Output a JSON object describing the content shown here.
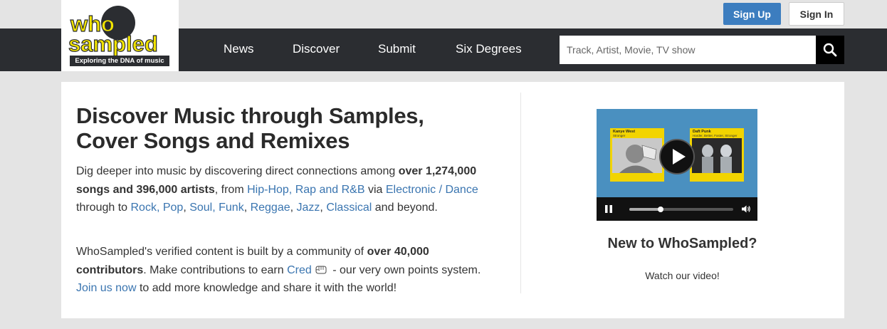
{
  "header": {
    "logo": {
      "who": "who",
      "sampled": "sampled",
      "tagline": "Exploring the DNA of music"
    },
    "sign_up": "Sign Up",
    "sign_in": "Sign In"
  },
  "nav": {
    "items": [
      "News",
      "Discover",
      "Submit",
      "Six Degrees"
    ],
    "search_placeholder": "Track, Artist, Movie, TV show"
  },
  "main": {
    "headline_line1": "Discover Music through Samples,",
    "headline_line2": "Cover Songs and Remixes",
    "intro": {
      "t1": "Dig deeper into music by discovering direct connections among ",
      "b1": "over 1,274,000 songs and 396,000 artists",
      "t2": ", from ",
      "l1": "Hip-Hop, Rap and R&B",
      "t3": " via ",
      "l2": "Electronic / Dance",
      "t4": " through to ",
      "l3": "Rock, Pop",
      "t5": ", ",
      "l4": "Soul, Funk",
      "t6": ", ",
      "l5": "Reggae",
      "t7": ", ",
      "l6": "Jazz",
      "t8": ", ",
      "l7": "Classical",
      "t9": " and beyond."
    },
    "community": {
      "t1": "WhoSampled's verified content is built by a community of ",
      "b1": "over 40,000 contributors",
      "t2": ". Make contributions to earn ",
      "l1": "Cred",
      "t3": " - our very own points system. ",
      "l2": "Join us now",
      "t4": " to add more knowledge and share it with the world!"
    }
  },
  "sidebar": {
    "video": {
      "left_artist": "Kanye West",
      "left_track": "Stronger",
      "right_artist": "Daft Punk",
      "right_track": "Harder, Better, Faster, Stronger",
      "progress": 0.3
    },
    "title": "New to WhoSampled?",
    "subtitle": "Watch our video!"
  },
  "colors": {
    "nav_bg": "#2b2d31",
    "signup_bg": "#3c7dbf",
    "link": "#3a75b0",
    "logo_yellow": "#f2e400",
    "video_bg": "#4a90c0",
    "thumb_yellow": "#f2d400"
  },
  "icons": {
    "search": "search-icon",
    "play": "play-icon",
    "pause": "pause-icon",
    "volume": "volume-icon",
    "cred": "cred-fist-icon"
  }
}
